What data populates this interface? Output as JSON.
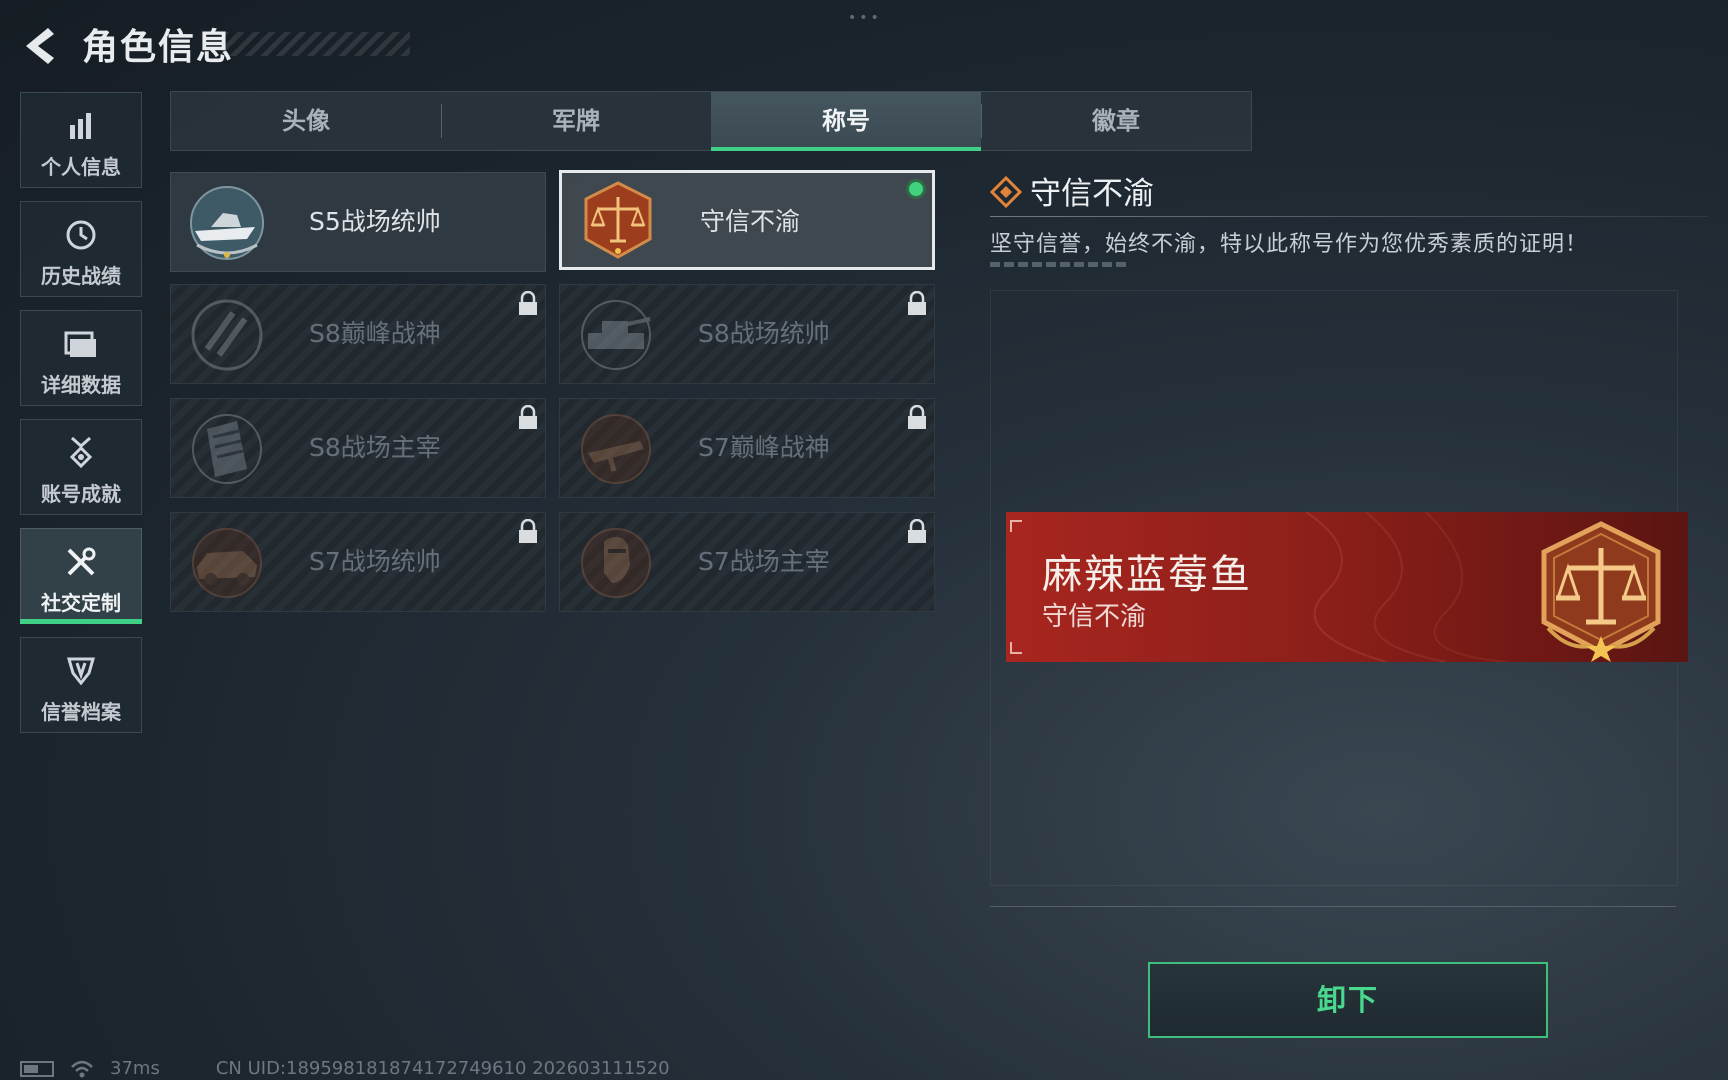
{
  "header": {
    "title": "角色信息"
  },
  "sidebar": {
    "items": [
      {
        "label": "个人信息",
        "icon": "bar-chart-icon",
        "active": false
      },
      {
        "label": "历史战绩",
        "icon": "history-clock-icon",
        "active": false
      },
      {
        "label": "详细数据",
        "icon": "folder-icon",
        "active": false
      },
      {
        "label": "账号成就",
        "icon": "medal-icon",
        "active": false
      },
      {
        "label": "社交定制",
        "icon": "tools-icon",
        "active": true
      },
      {
        "label": "信誉档案",
        "icon": "shield-badge-icon",
        "active": false
      }
    ]
  },
  "tabs": [
    {
      "label": "头像",
      "active": false
    },
    {
      "label": "军牌",
      "active": false
    },
    {
      "label": "称号",
      "active": true
    },
    {
      "label": "徽章",
      "active": false
    }
  ],
  "titles": [
    {
      "name": "S5战场统帅",
      "emblem": "boat-emblem-icon",
      "locked": false,
      "selected": false
    },
    {
      "name": "守信不渝",
      "emblem": "scales-emblem-icon",
      "locked": false,
      "selected": true,
      "equipped": true
    },
    {
      "name": "S8巅峰战神",
      "emblem": "slash-emblem-icon",
      "locked": true,
      "selected": false
    },
    {
      "name": "S8战场统帅",
      "emblem": "tank-emblem-icon",
      "locked": true,
      "selected": false
    },
    {
      "name": "S8战场主宰",
      "emblem": "building-emblem-icon",
      "locked": true,
      "selected": false
    },
    {
      "name": "S7巅峰战神",
      "emblem": "rifle-emblem-icon",
      "locked": true,
      "selected": false
    },
    {
      "name": "S7战场统帅",
      "emblem": "vehicle-emblem-icon",
      "locked": true,
      "selected": false
    },
    {
      "name": "S7战场主宰",
      "emblem": "soldier-emblem-icon",
      "locked": true,
      "selected": false
    }
  ],
  "detail": {
    "title": "守信不渝",
    "description": "坚守信誉，始终不渝，特以此称号作为您优秀素质的证明！"
  },
  "preview": {
    "player_name": "麻辣蓝莓鱼",
    "title": "守信不渝"
  },
  "actions": {
    "unequip_label": "卸下"
  },
  "status_bar": {
    "ping": "37ms",
    "uid": "CN UID:1895981818741727496​10 202603111520"
  },
  "colors": {
    "accent_green": "#3fd286",
    "banner_red": "#a8261f",
    "emblem_bronze": "#b8642a"
  }
}
